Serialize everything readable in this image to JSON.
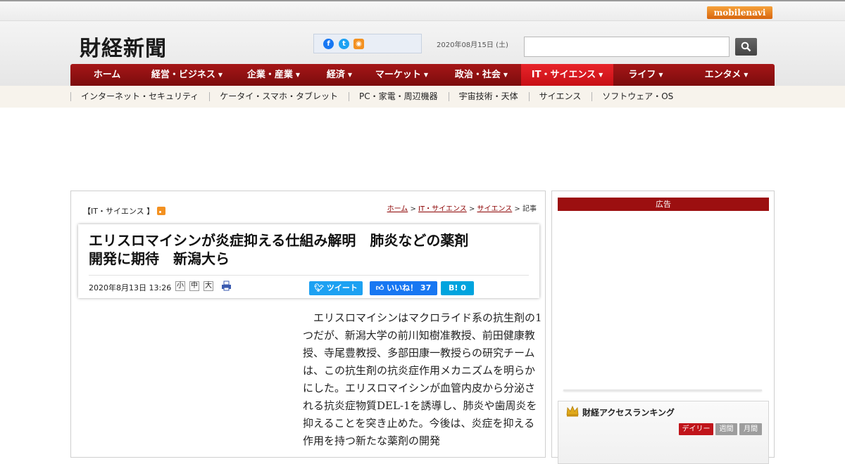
{
  "topbar": {
    "mobile_logo": "mobilenavi"
  },
  "header": {
    "site_logo": "財経新聞",
    "date": "2020年08月15日 (土)",
    "search_placeholder": ""
  },
  "nav": {
    "items": [
      {
        "label": "ホーム",
        "caret": false,
        "active": false
      },
      {
        "label": "経営・ビジネス",
        "caret": true,
        "active": false
      },
      {
        "label": "企業・産業",
        "caret": true,
        "active": false
      },
      {
        "label": "経済",
        "caret": true,
        "active": false
      },
      {
        "label": "マーケット",
        "caret": true,
        "active": false
      },
      {
        "label": "政治・社会",
        "caret": true,
        "active": false
      },
      {
        "label": "IT・サイエンス",
        "caret": true,
        "active": true
      },
      {
        "label": "ライフ",
        "caret": true,
        "active": false
      },
      {
        "label": "エンタメ",
        "caret": true,
        "active": false
      }
    ]
  },
  "subnav": {
    "items": [
      "インターネット・セキュリティ",
      "ケータイ・スマホ・タブレット",
      "PC・家電・周辺機器",
      "宇宙技術・天体",
      "サイエンス",
      "ソフトウェア・OS"
    ]
  },
  "article": {
    "category": "【IT・サイエンス 】",
    "breadcrumb": {
      "home": "ホーム",
      "sep": " > ",
      "cat": "IT・サイエンス",
      "sub": "サイエンス",
      "current": "記事"
    },
    "headline_line1": "エリスロマイシンが炎症抑える仕組み解明　肺炎などの薬剤",
    "headline_line2": "開発に期待　新潟大ら",
    "date": "2020年8月13日 13:26",
    "font_sizes": [
      "小",
      "中",
      "大"
    ],
    "tweet_label": "ツイート",
    "like_label": "いいね！",
    "like_count": "37",
    "hatena_label": "B!",
    "hatena_count": "0",
    "body": "エリスロマイシンはマクロライド系の抗生剤の1つだが、新潟大学の前川知樹准教授、前田健康教授、寺尾豊教授、多部田康一教授らの研究チームは、この抗生剤の抗炎症作用メカニズムを明らかにした。エリスロマイシンが血管内皮から分泌される抗炎症物質DEL-1を誘導し、肺炎や歯周炎を抑えることを突き止めた。今後は、炎症を抑える作用を持つ新たな薬剤の開発"
  },
  "sidebar": {
    "ad_label": "広告",
    "ranking_title": "財経アクセスランキング",
    "tabs": [
      "デイリー",
      "週間",
      "月間"
    ]
  },
  "colors": {
    "nav_red": "#8b0e0f",
    "nav_active": "#d41a20",
    "accent_orange": "#f39121"
  }
}
